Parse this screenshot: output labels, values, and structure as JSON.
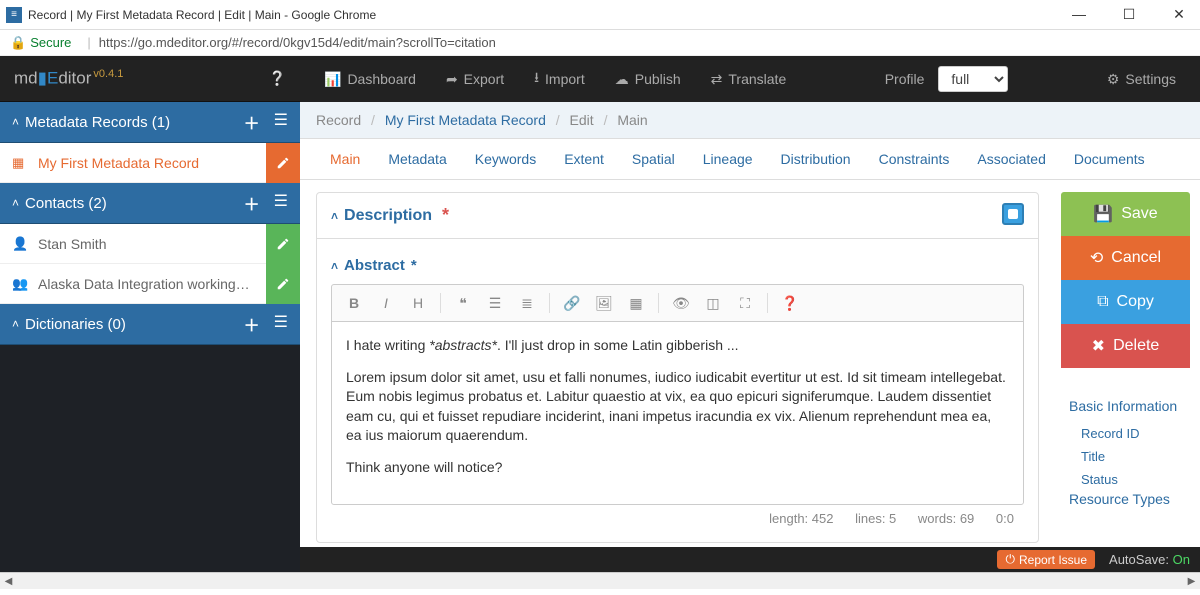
{
  "window": {
    "title": "Record | My First Metadata Record | Edit | Main - Google Chrome",
    "secure": "Secure",
    "url": "https://go.mdeditor.org/#/record/0kgv15d4/edit/main?scrollTo=citation"
  },
  "brand": {
    "name_pre": "md",
    "name_mid": "E",
    "name_post": "ditor",
    "version": "v0.4.1"
  },
  "nav": {
    "dashboard": "Dashboard",
    "export": "Export",
    "import": "Import",
    "publish": "Publish",
    "translate": "Translate",
    "profile_label": "Profile",
    "profile_value": "full",
    "settings": "Settings"
  },
  "sidebar": {
    "records_label": "Metadata Records (1)",
    "records": [
      {
        "label": "My First Metadata Record",
        "selected": true
      }
    ],
    "contacts_label": "Contacts (2)",
    "contacts": [
      {
        "label": "Stan Smith"
      },
      {
        "label": "Alaska Data Integration working…"
      }
    ],
    "dict_label": "Dictionaries (0)"
  },
  "breadcrumb": {
    "a": "Record",
    "b": "My First Metadata Record",
    "c": "Edit",
    "d": "Main"
  },
  "tabs": [
    "Main",
    "Metadata",
    "Keywords",
    "Extent",
    "Spatial",
    "Lineage",
    "Distribution",
    "Constraints",
    "Associated",
    "Documents"
  ],
  "desc_label": "Description",
  "abstract_label": "Abstract",
  "abstract_body": {
    "p1_pre": "I hate writing ",
    "p1_em": "*abstracts*",
    "p1_post": ".  I'll just drop in some Latin gibberish ...",
    "p2": "Lorem ipsum dolor sit amet, usu et falli nonumes, iudico iudicabit evertitur ut est. Id sit timeam intellegebat. Eum nobis legimus probatus et. Labitur quaestio at vix, ea quo epicuri signiferumque. Laudem dissentiet eam cu, qui et fuisset repudiare inciderint, inani impetus iracundia ex vix. Alienum reprehendunt mea ea, ea ius maiorum quaerendum.",
    "p3": "Think anyone will notice?"
  },
  "status": {
    "length": "length: 452",
    "lines": "lines: 5",
    "words": "words: 69",
    "pos": "0:0"
  },
  "actions": {
    "save": "Save",
    "cancel": "Cancel",
    "copy": "Copy",
    "delete": "Delete"
  },
  "quicknav": {
    "basic": "Basic Information",
    "record_id": "Record ID",
    "title": "Title",
    "status": "Status",
    "resource": "Resource Types"
  },
  "footer": {
    "report": "Report Issue",
    "autosave_label": "AutoSave:",
    "autosave_state": "On"
  }
}
